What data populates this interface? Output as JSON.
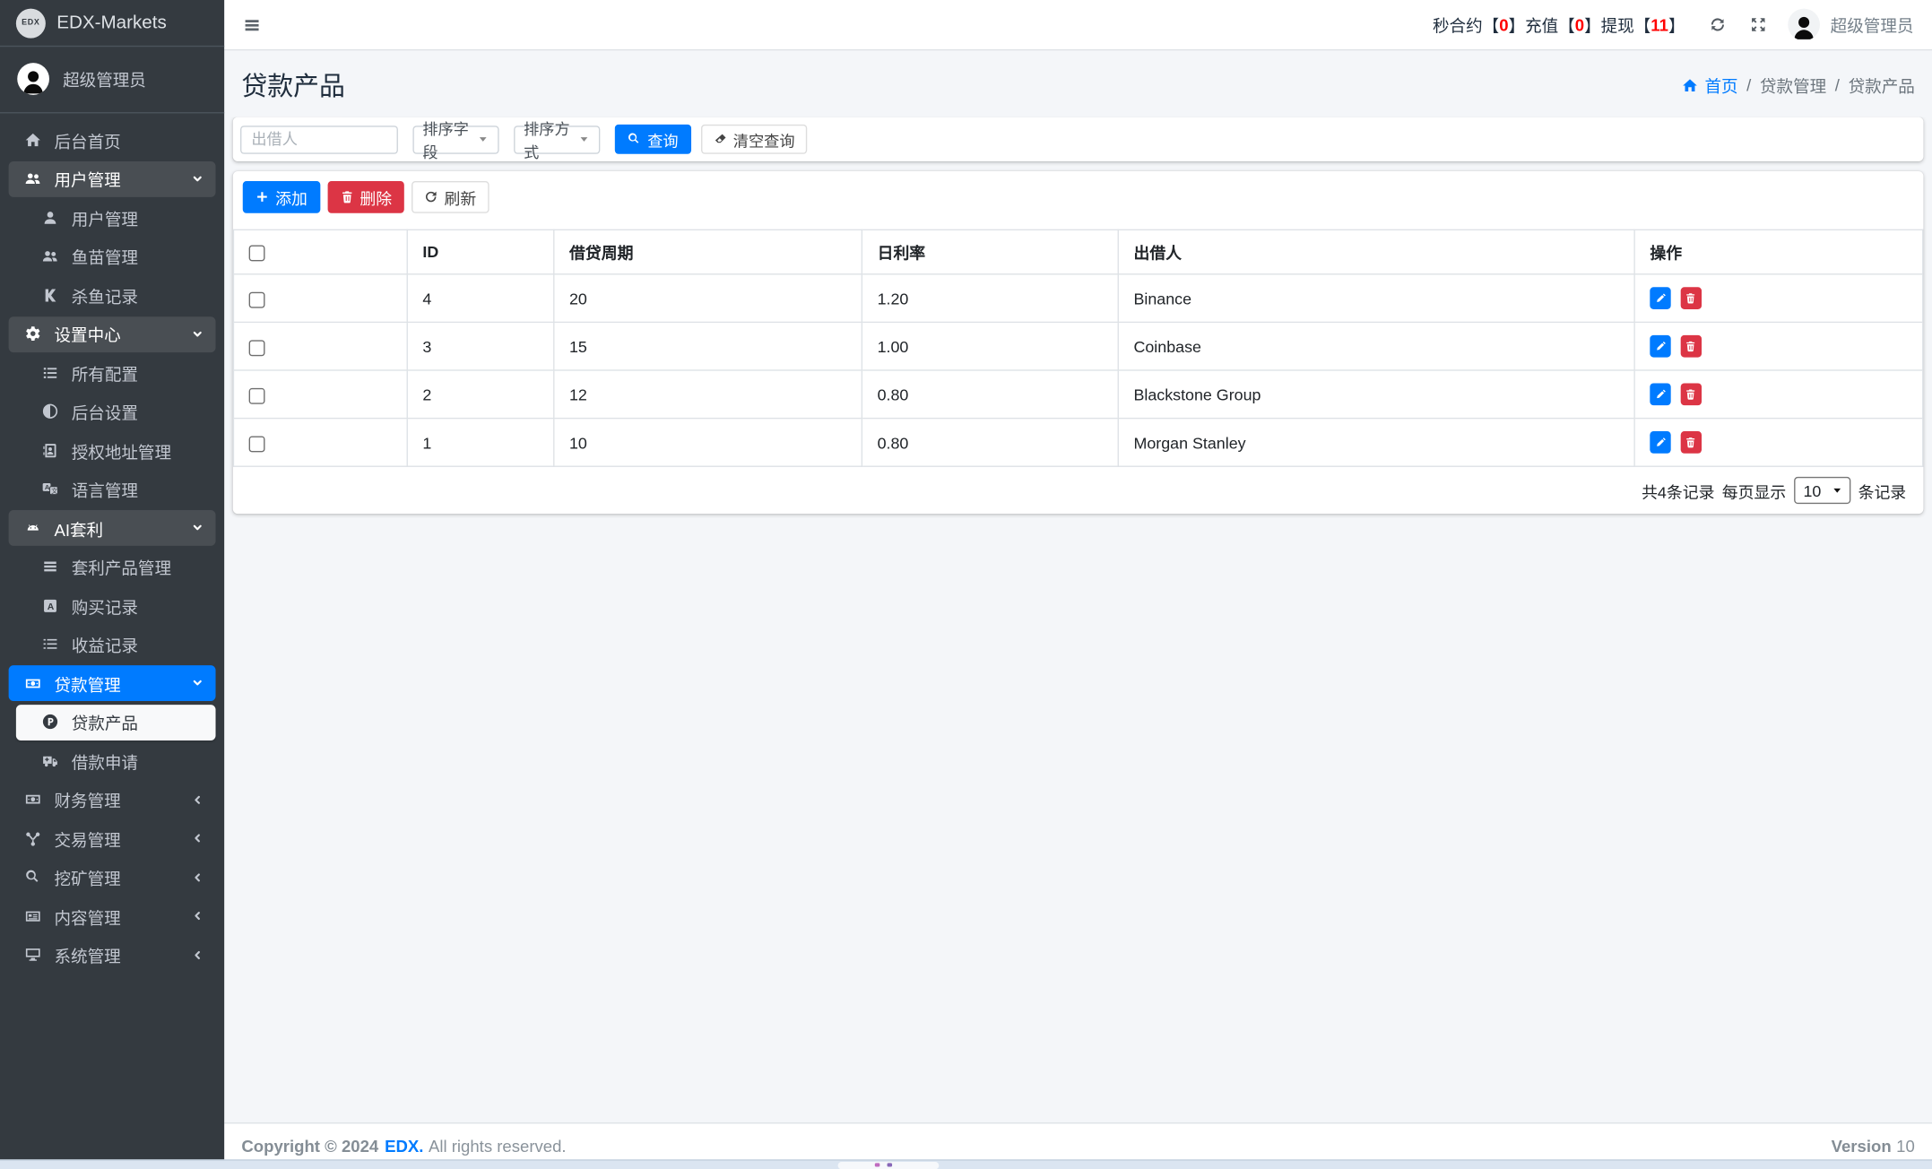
{
  "brand": {
    "logo": "EDX",
    "name": "EDX-Markets"
  },
  "sidebar": {
    "user": {
      "name": "超级管理员"
    },
    "menu": [
      {
        "label": "后台首页",
        "icon": "home"
      },
      {
        "label": "用户管理",
        "icon": "users"
      },
      {
        "label": "用户管理",
        "icon": "user"
      },
      {
        "label": "鱼苗管理",
        "icon": "users"
      },
      {
        "label": "杀鱼记录",
        "icon": "k"
      },
      {
        "label": "设置中心",
        "icon": "cogs"
      },
      {
        "label": "所有配置",
        "icon": "list"
      },
      {
        "label": "后台设置",
        "icon": "adjust"
      },
      {
        "label": "授权地址管理",
        "icon": "address-book"
      },
      {
        "label": "语言管理",
        "icon": "language"
      },
      {
        "label": "AI套利",
        "icon": "android"
      },
      {
        "label": "套利产品管理",
        "icon": "bars"
      },
      {
        "label": "购买记录",
        "icon": "a-square"
      },
      {
        "label": "收益记录",
        "icon": "tasks"
      },
      {
        "label": "贷款管理",
        "icon": "money"
      },
      {
        "label": "贷款产品",
        "icon": "p-circle"
      },
      {
        "label": "借款申请",
        "icon": "ambulance"
      },
      {
        "label": "财务管理",
        "icon": "money"
      },
      {
        "label": "交易管理",
        "icon": "sitemap"
      },
      {
        "label": "挖矿管理",
        "icon": "search"
      },
      {
        "label": "内容管理",
        "icon": "newspaper"
      },
      {
        "label": "系统管理",
        "icon": "desktop"
      }
    ]
  },
  "navbar": {
    "stats": [
      {
        "label": "秒合约",
        "value": "0"
      },
      {
        "label": "充值",
        "value": "0"
      },
      {
        "label": "提现",
        "value": "11"
      }
    ],
    "bracket_open": "【",
    "bracket_close": "】",
    "user_name": "超级管理员"
  },
  "page": {
    "title": "贷款产品",
    "breadcrumb": {
      "home": "首页",
      "section": "贷款管理",
      "current": "贷款产品",
      "separator": "/"
    }
  },
  "filters": {
    "lender_placeholder": "出借人",
    "sort_field": "排序字段",
    "sort_order": "排序方式",
    "search": "查询",
    "clear": "清空查询"
  },
  "toolbar": {
    "add": "添加",
    "delete": "删除",
    "refresh": "刷新"
  },
  "table": {
    "columns": {
      "id": "ID",
      "period": "借贷周期",
      "daily_rate": "日利率",
      "lender": "出借人",
      "actions": "操作"
    },
    "rows": [
      {
        "id": "4",
        "period": "20",
        "daily_rate": "1.20",
        "lender": "Binance"
      },
      {
        "id": "3",
        "period": "15",
        "daily_rate": "1.00",
        "lender": "Coinbase"
      },
      {
        "id": "2",
        "period": "12",
        "daily_rate": "0.80",
        "lender": "Blackstone Group"
      },
      {
        "id": "1",
        "period": "10",
        "daily_rate": "0.80",
        "lender": "Morgan Stanley"
      }
    ]
  },
  "pagination": {
    "total": "共4条记录",
    "per_page_prefix": "每页显示",
    "per_page": "10",
    "per_page_suffix": "条记录"
  },
  "footer": {
    "copyright": "Copyright © 2024",
    "brand": "EDX.",
    "rights": "All rights reserved.",
    "version_label": "Version",
    "version": "10"
  },
  "colors": {
    "primary": "#007bff",
    "danger": "#dc3545",
    "red": "#ff0000",
    "sidebar-bg": "#343a40",
    "content-bg": "#f4f6f9"
  },
  "icons": {
    "menu-toggle": "bars",
    "navbar-refresh": "sync",
    "fullscreen": "expand",
    "avatar": "person",
    "breadcrumb-home": "home",
    "search-button": "search",
    "clear-button": "eraser",
    "add-button": "plus",
    "delete-button": "trash",
    "refresh-button": "redo",
    "edit-row": "pencil",
    "delete-row": "trash",
    "select-caret": "caret-down",
    "chevron-open": "chevron-down",
    "chevron-closed": "chevron-left"
  }
}
